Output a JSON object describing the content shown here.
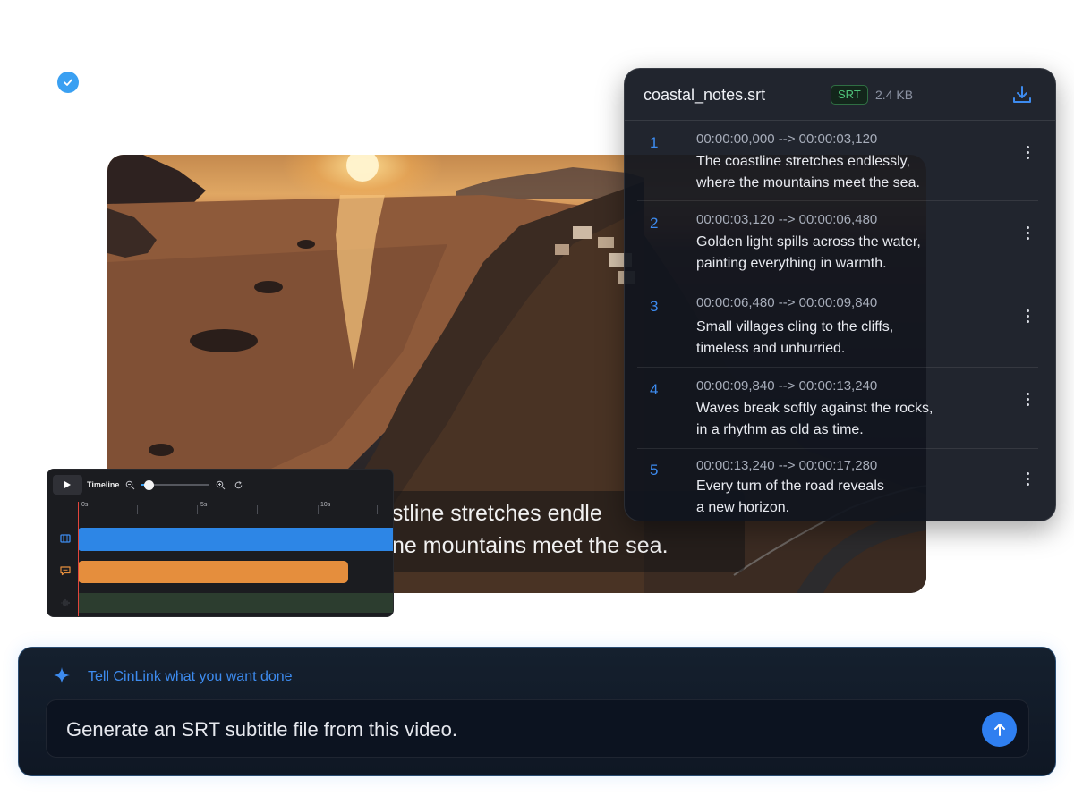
{
  "subtitle_panel": {
    "filename": "coastal_notes.srt",
    "format_tag": "SRT",
    "file_size": "2.4 KB",
    "cues": [
      {
        "index": "1",
        "time": "00:00:00,000  --> 00:00:03,120",
        "line1": "The coastline stretches endlessly,",
        "line2": "where the mountains meet the sea."
      },
      {
        "index": "2",
        "time": "00:00:03,120  --> 00:00:06,480",
        "line1": "Golden light spills across the water,",
        "line2": "painting everything in warmth."
      },
      {
        "index": "3",
        "time": "00:00:06,480  --> 00:00:09,840",
        "line1": "Small villages cling to the cliffs,",
        "line2": "timeless and unhurried."
      },
      {
        "index": "4",
        "time": "00:00:09,840 --> 00:00:13,240",
        "line1": "Waves break softly against the rocks,",
        "line2": "in a rhythm as old as time."
      },
      {
        "index": "5",
        "time": "00:00:13,240  --> 00:00:17,280",
        "line1": "Every turn of the road reveals",
        "line2": "a new horizon."
      }
    ]
  },
  "video": {
    "caption_line1": "astline stretches endle",
    "caption_line2": "ne mountains meet the sea."
  },
  "timeline": {
    "title": "Timeline",
    "zoom_level": 0.12,
    "ruler_labels": [
      "0s",
      "5s",
      "10s"
    ]
  },
  "prompt": {
    "hint": "Tell CinLink what you want done",
    "value": "Generate an SRT subtitle file from this video."
  },
  "icons": {
    "check": "check-icon",
    "download": "download-icon",
    "play": "play-icon",
    "spark": "sparkle-icon",
    "send": "arrow-up-icon"
  },
  "colors": {
    "accent": "#3d8bef",
    "srt_tag": "#4fc27a",
    "video_track": "#2d86e6",
    "subtitle_track": "#e58e3d",
    "audio_track": "#2c3d2f",
    "playhead": "#e2453c"
  }
}
